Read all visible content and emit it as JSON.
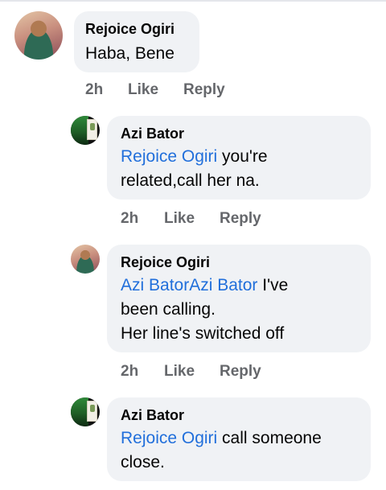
{
  "comments": [
    {
      "author": "Rejoice Ogiri",
      "text": "Haba, Bene",
      "time": "2h",
      "like_label": "Like",
      "reply_label": "Reply"
    },
    {
      "author": "Azi Bator",
      "mention": "Rejoice Ogiri",
      "text_line1": " you're",
      "text_line2": "related,call her na.",
      "time": "2h",
      "like_label": "Like",
      "reply_label": "Reply"
    },
    {
      "author": "Rejoice Ogiri",
      "mention": "Azi BatorAzi Bator",
      "text_line1": " I've",
      "text_line2": "been calling.",
      "text_line3": "Her line's switched off",
      "time": "2h",
      "like_label": "Like",
      "reply_label": "Reply"
    },
    {
      "author": "Azi Bator",
      "mention": "Rejoice Ogiri",
      "text_line1": " call someone",
      "text_line2": "close."
    }
  ],
  "icons": {
    "rejoice_avatar": "profile-photo-woman",
    "azi_avatar": "profile-photo-card"
  },
  "colors": {
    "bubble_bg": "#f0f2f5",
    "mention": "#216fdb",
    "meta": "#65676b"
  }
}
